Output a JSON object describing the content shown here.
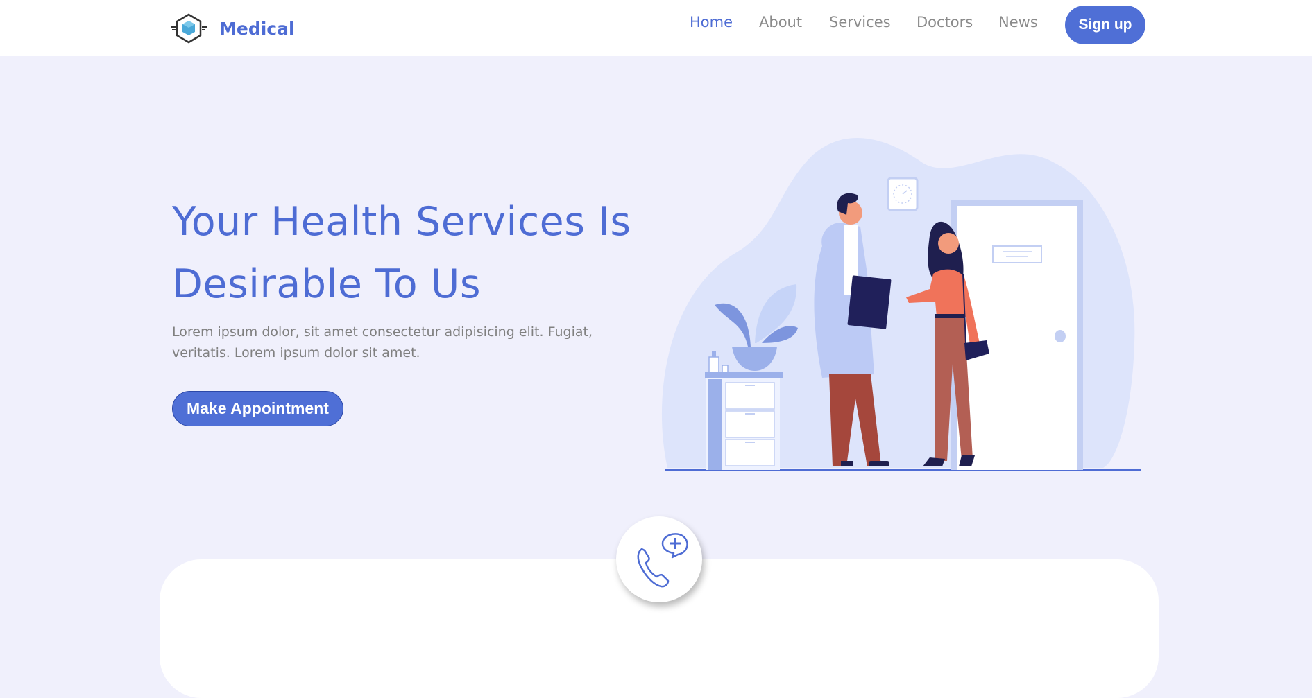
{
  "brand": {
    "name": "Medical",
    "logo_icon": "hexagon-cube-logo-icon"
  },
  "nav": {
    "items": [
      {
        "label": "Home",
        "active": true
      },
      {
        "label": "About",
        "active": false
      },
      {
        "label": "Services",
        "active": false
      },
      {
        "label": "Doctors",
        "active": false
      },
      {
        "label": "News",
        "active": false
      }
    ],
    "signup_label": "Sign up"
  },
  "hero": {
    "title_line1": "Your Health Services Is",
    "title_line2": "Desirable To Us",
    "description": "Lorem ipsum dolor, sit amet consectetur adipisicing elit. Fugiat, veritatis. Lorem ipsum dolor sit amet.",
    "cta_label": "Make Appointment",
    "illustration": "doctor-and-patient-illustration"
  },
  "contact": {
    "icon": "phone-medical-chat-icon"
  },
  "colors": {
    "accent": "#4e6cd4",
    "background": "#f0f0fc",
    "muted_text": "#8a8a8a"
  }
}
